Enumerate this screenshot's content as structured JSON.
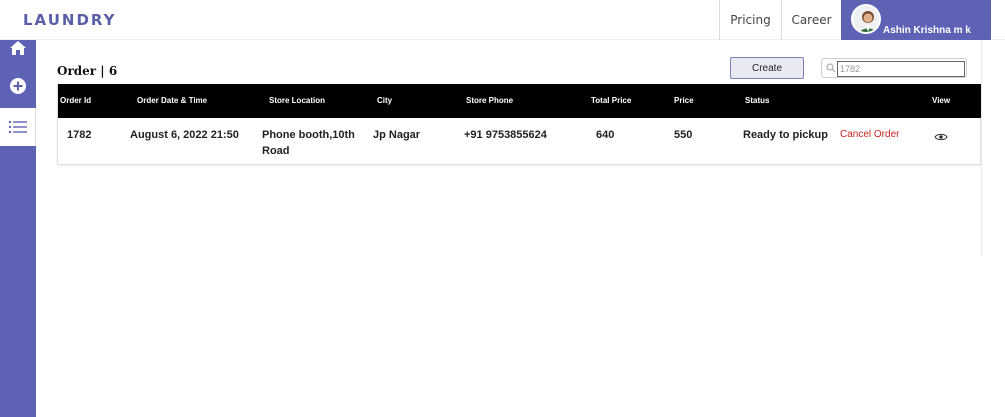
{
  "app": {
    "brand": "LAUNDRY"
  },
  "nav": {
    "pricing": "Pricing",
    "career": "Career"
  },
  "user": {
    "name": "Ashin Krishna m k"
  },
  "sidebar": {
    "items": [
      {
        "icon": "home-icon"
      },
      {
        "icon": "add-circle-icon"
      },
      {
        "icon": "list-icon",
        "active": true
      }
    ]
  },
  "orders": {
    "title": "Order | 6",
    "create_label": "Create",
    "search_value": "1782",
    "columns": [
      "Order Id",
      "Order Date & Time",
      "Store Location",
      "City",
      "Store Phone",
      "Total Price",
      "Price",
      "Status",
      "View"
    ],
    "rows": [
      {
        "order_id": "1782",
        "date_time": "August 6, 2022 21:50",
        "store_location": "Phone booth,10th Road",
        "city": "Jp Nagar",
        "store_phone": "+91 9753855624",
        "total_price": "640",
        "price": "550",
        "status": "Ready to pickup",
        "action": "Cancel Order"
      }
    ]
  },
  "colors": {
    "primary": "#5d62b5",
    "header_bg": "#000000",
    "cancel": "#cc2222",
    "brand": "#5a5fa8"
  }
}
